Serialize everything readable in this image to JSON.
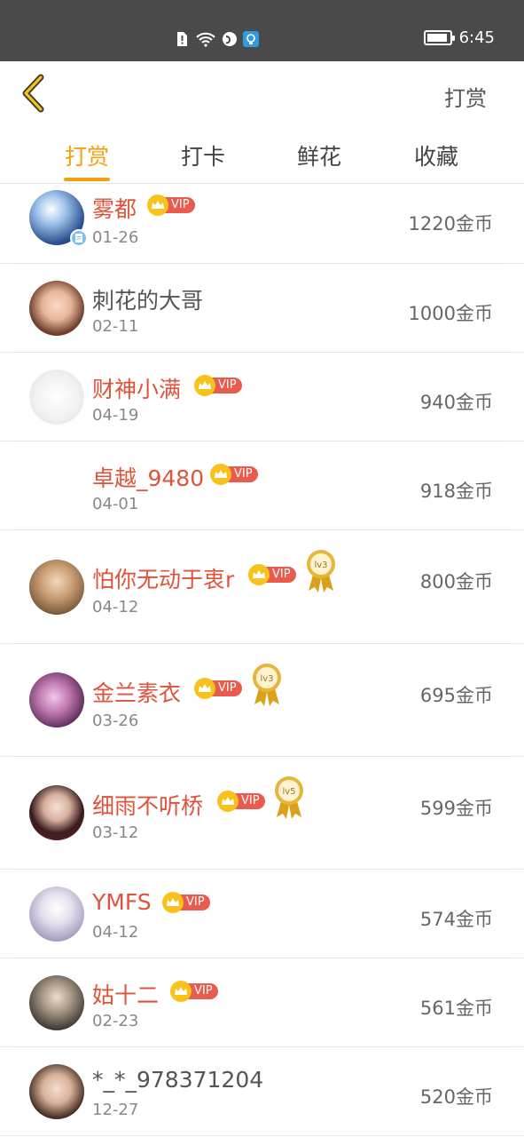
{
  "status_bar": {
    "time": "6:45"
  },
  "header": {
    "action_label": "打赏"
  },
  "tabs": [
    {
      "label": "打赏",
      "active": true
    },
    {
      "label": "打卡",
      "active": false
    },
    {
      "label": "鲜花",
      "active": false
    },
    {
      "label": "收藏",
      "active": false
    }
  ],
  "colors": {
    "accent": "#f5a10e",
    "vip_name": "#e0533a",
    "vip_tag": "#e95b4c"
  },
  "vip_label": "VIP",
  "rows": [
    {
      "name": "雾都",
      "date": "01-26",
      "amount": "1220金币",
      "vip": true
    },
    {
      "name": "刺花的大哥",
      "date": "02-11",
      "amount": "1000金币",
      "vip": false
    },
    {
      "name": "财神小满",
      "date": "04-19",
      "amount": "940金币",
      "vip": true
    },
    {
      "name": "卓越_9480",
      "date": "04-01",
      "amount": "918金币",
      "vip": true
    },
    {
      "name": "怕你无动于衷r",
      "date": "04-12",
      "amount": "800金币",
      "vip": true,
      "level": "lv3"
    },
    {
      "name": "金兰素衣",
      "date": "03-26",
      "amount": "695金币",
      "vip": true,
      "level": "lv3"
    },
    {
      "name": "细雨不听桥",
      "date": "03-12",
      "amount": "599金币",
      "vip": true,
      "level": "lv5"
    },
    {
      "name": "YMFS",
      "date": "04-12",
      "amount": "574金币",
      "vip": true
    },
    {
      "name": "姑十二",
      "date": "02-23",
      "amount": "561金币",
      "vip": true
    },
    {
      "name": "*_*_978371204",
      "date": "12-27",
      "amount": "520金币",
      "vip": false
    }
  ]
}
